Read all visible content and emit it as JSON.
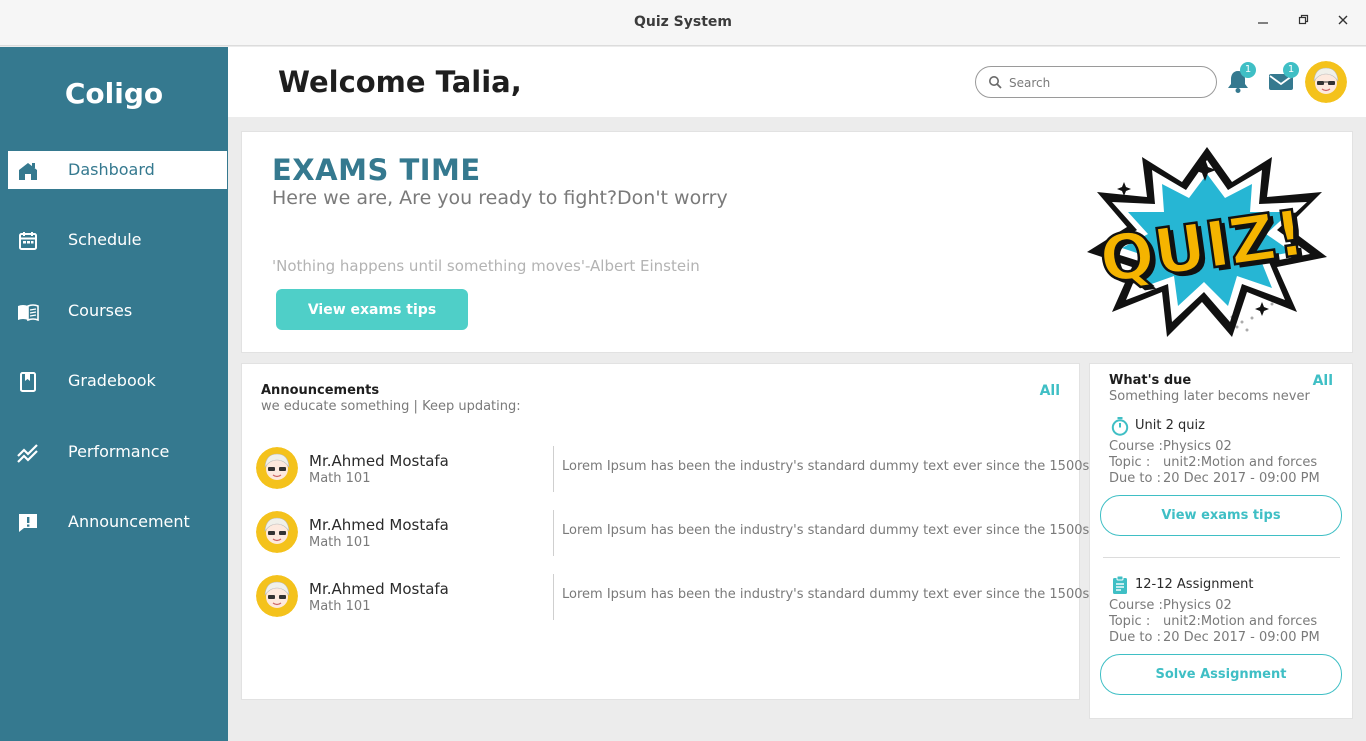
{
  "window": {
    "title": "Quiz System"
  },
  "sidebar": {
    "brand": "Coligo",
    "items": [
      {
        "label": "Dashboard",
        "icon": "home-icon",
        "active": true
      },
      {
        "label": "Schedule",
        "icon": "calendar-icon"
      },
      {
        "label": "Courses",
        "icon": "book-icon"
      },
      {
        "label": "Gradebook",
        "icon": "bookmark-book-icon"
      },
      {
        "label": "Performance",
        "icon": "trend-chart-icon"
      },
      {
        "label": "Announcement",
        "icon": "alert-message-icon"
      }
    ]
  },
  "header": {
    "welcome": "Welcome Talia,",
    "search_placeholder": "Search",
    "notifications_count": "1",
    "messages_count": "1"
  },
  "hero": {
    "title": "EXAMS TIME",
    "subtitle": "Here we are, Are you ready to fight?Don't worry",
    "quote": "'Nothing happens until something moves'-Albert Einstein",
    "button": "View exams tips",
    "art_text": "QUIZ!"
  },
  "announcements": {
    "title": "Announcements",
    "subtitle": "we educate something | Keep updating:",
    "all_label": "All",
    "items": [
      {
        "name": "Mr.Ahmed Mostafa",
        "course": "Math 101",
        "message": "Lorem Ipsum has been the industry's standard dummy text ever since the 1500s"
      },
      {
        "name": "Mr.Ahmed Mostafa",
        "course": "Math 101",
        "message": "Lorem Ipsum has been the industry's standard dummy text ever since the 1500s"
      },
      {
        "name": "Mr.Ahmed Mostafa",
        "course": "Math 101",
        "message": "Lorem Ipsum has been the industry's standard dummy text ever since the 1500s"
      }
    ]
  },
  "due": {
    "title": "What's due",
    "subtitle": "Something later becoms never",
    "all_label": "All",
    "items": [
      {
        "icon": "stopwatch-icon",
        "title": "Unit 2 quiz",
        "course_key": "Course :",
        "course": "Physics 02",
        "topic_key": "Topic :",
        "topic": "unit2:Motion and forces",
        "due_key": "Due to :",
        "due": "20 Dec 2017 - 09:00 PM",
        "button": "View exams tips"
      },
      {
        "icon": "clipboard-icon",
        "title": "12-12 Assignment",
        "course_key": "Course :",
        "course": "Physics 02",
        "topic_key": "Topic :",
        "topic": "unit2:Motion and forces",
        "due_key": "Due to :",
        "due": "20 Dec 2017 - 09:00 PM",
        "button": "Solve Assignment"
      }
    ]
  },
  "colors": {
    "sidebar": "#35798f",
    "accent": "#3fbfc5",
    "button": "#4fcfc8",
    "title": "#35798f"
  }
}
